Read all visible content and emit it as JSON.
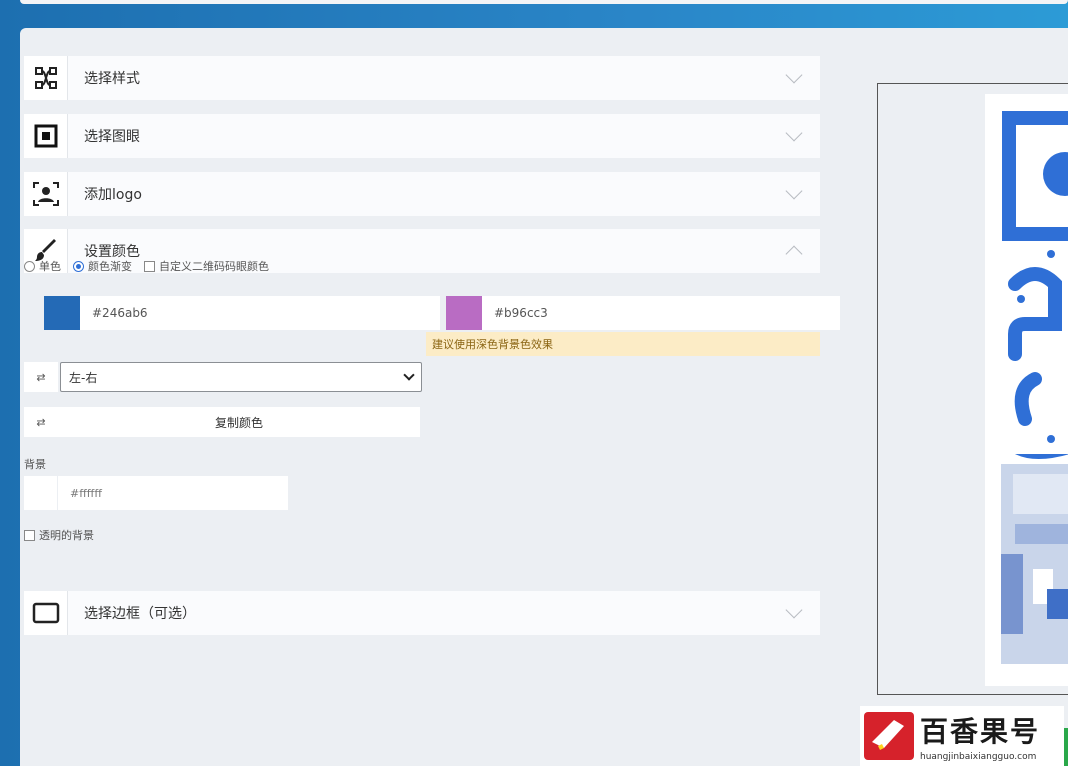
{
  "accordion": {
    "style": {
      "label": "选择样式",
      "icon": "butterfly-pattern-icon"
    },
    "border_pattern": {
      "label": "选择图眼",
      "icon": "square-eye-icon"
    },
    "logo": {
      "label": "添加logo",
      "icon": "user-portrait-icon"
    },
    "color": {
      "label": "设置颜色",
      "icon": "paint-brush-icon"
    },
    "frame": {
      "label": "选择边框（可选）",
      "icon": "rectangle-frame-icon"
    }
  },
  "color_panel": {
    "mode_single": "单色",
    "mode_gradient": "颜色渐变",
    "custom_eye_color": "自定义二维码码眼颜色",
    "color1": {
      "hex": "#246ab6",
      "label": "#246ab6"
    },
    "color2": {
      "hex": "#b96cc3",
      "label": "#b96cc3"
    },
    "warning": "建议使用深色背景色效果",
    "direction_icon": "gradient-direction-icon",
    "direction_value": "左-右",
    "copy_icon": "copy-icon",
    "copy_label": "复制颜色",
    "bg_label": "背景",
    "bg_value": "#ffffff",
    "transparent_bg": "透明的背景"
  },
  "watermark": {
    "title": "百香果号",
    "url": "huangjinbaixiangguo.com"
  },
  "colors": {
    "accent": "#2f6fd6",
    "qr_blue": "#2f6fd6",
    "warn_bg": "#fcecc6",
    "brand_red": "#d6222b"
  }
}
